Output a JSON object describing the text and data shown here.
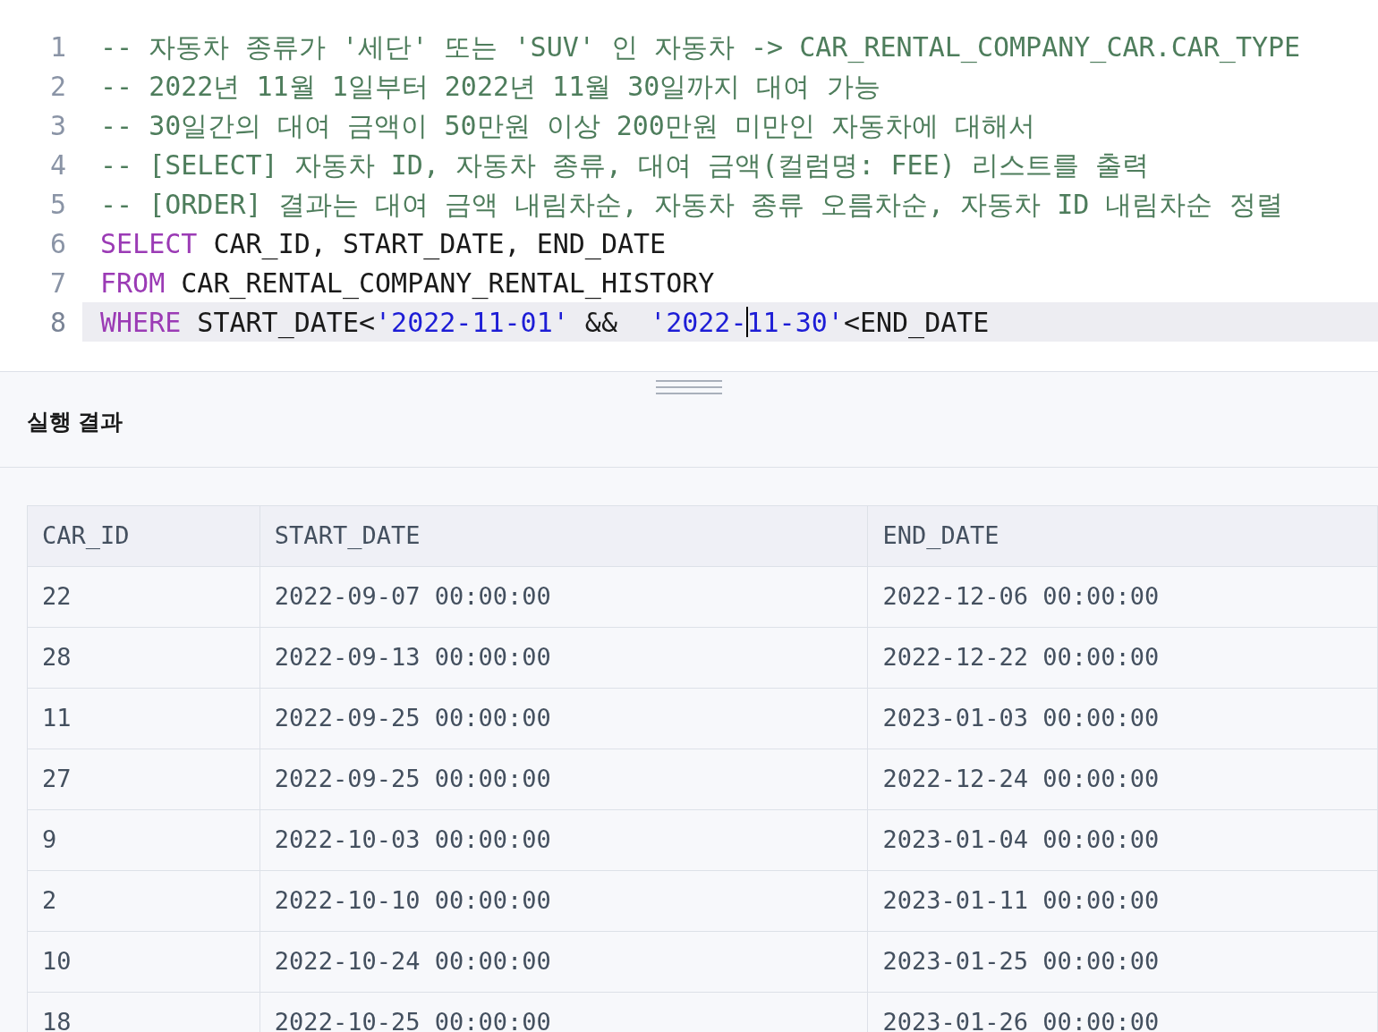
{
  "editor": {
    "lines": [
      {
        "number": "1",
        "current": false,
        "tokens": [
          {
            "kind": "comment",
            "text": "-- 자동차 종류가 '세단' 또는 'SUV' 인 자동차 -> CAR_RENTAL_COMPANY_CAR.CAR_TYPE"
          }
        ]
      },
      {
        "number": "2",
        "current": false,
        "tokens": [
          {
            "kind": "comment",
            "text": "-- 2022년 11월 1일부터 2022년 11월 30일까지 대여 가능"
          }
        ]
      },
      {
        "number": "3",
        "current": false,
        "tokens": [
          {
            "kind": "comment",
            "text": "-- 30일간의 대여 금액이 50만원 이상 200만원 미만인 자동차에 대해서"
          }
        ]
      },
      {
        "number": "4",
        "current": false,
        "tokens": [
          {
            "kind": "comment",
            "text": "-- [SELECT] 자동차 ID, 자동차 종류, 대여 금액(컬럼명: FEE) 리스트를 출력"
          }
        ]
      },
      {
        "number": "5",
        "current": false,
        "tokens": [
          {
            "kind": "comment",
            "text": "-- [ORDER] 결과는 대여 금액 내림차순, 자동차 종류 오름차순, 자동차 ID 내림차순 정렬"
          }
        ]
      },
      {
        "number": "6",
        "current": false,
        "tokens": [
          {
            "kind": "keyword",
            "text": "SELECT"
          },
          {
            "kind": "plain",
            "text": " CAR_ID, START_DATE, END_DATE"
          }
        ]
      },
      {
        "number": "7",
        "current": false,
        "tokens": [
          {
            "kind": "keyword",
            "text": "FROM"
          },
          {
            "kind": "plain",
            "text": " CAR_RENTAL_COMPANY_RENTAL_HISTORY"
          }
        ]
      },
      {
        "number": "8",
        "current": true,
        "tokens": [
          {
            "kind": "keyword",
            "text": "WHERE"
          },
          {
            "kind": "plain",
            "text": " START_DATE<"
          },
          {
            "kind": "string",
            "text": "'2022-11-01'"
          },
          {
            "kind": "plain",
            "text": " &&  "
          },
          {
            "kind": "string",
            "text": "'2022-"
          },
          {
            "kind": "cursor"
          },
          {
            "kind": "string",
            "text": "11-30'"
          },
          {
            "kind": "plain",
            "text": "<END_DATE"
          }
        ]
      }
    ]
  },
  "result": {
    "title": "실행 결과",
    "columns": [
      "CAR_ID",
      "START_DATE",
      "END_DATE"
    ],
    "rows": [
      [
        "22",
        "2022-09-07 00:00:00",
        "2022-12-06 00:00:00"
      ],
      [
        "28",
        "2022-09-13 00:00:00",
        "2022-12-22 00:00:00"
      ],
      [
        "11",
        "2022-09-25 00:00:00",
        "2023-01-03 00:00:00"
      ],
      [
        "27",
        "2022-09-25 00:00:00",
        "2022-12-24 00:00:00"
      ],
      [
        "9",
        "2022-10-03 00:00:00",
        "2023-01-04 00:00:00"
      ],
      [
        "2",
        "2022-10-10 00:00:00",
        "2023-01-11 00:00:00"
      ],
      [
        "10",
        "2022-10-24 00:00:00",
        "2023-01-25 00:00:00"
      ],
      [
        "18",
        "2022-10-25 00:00:00",
        "2023-01-26 00:00:00"
      ]
    ]
  }
}
